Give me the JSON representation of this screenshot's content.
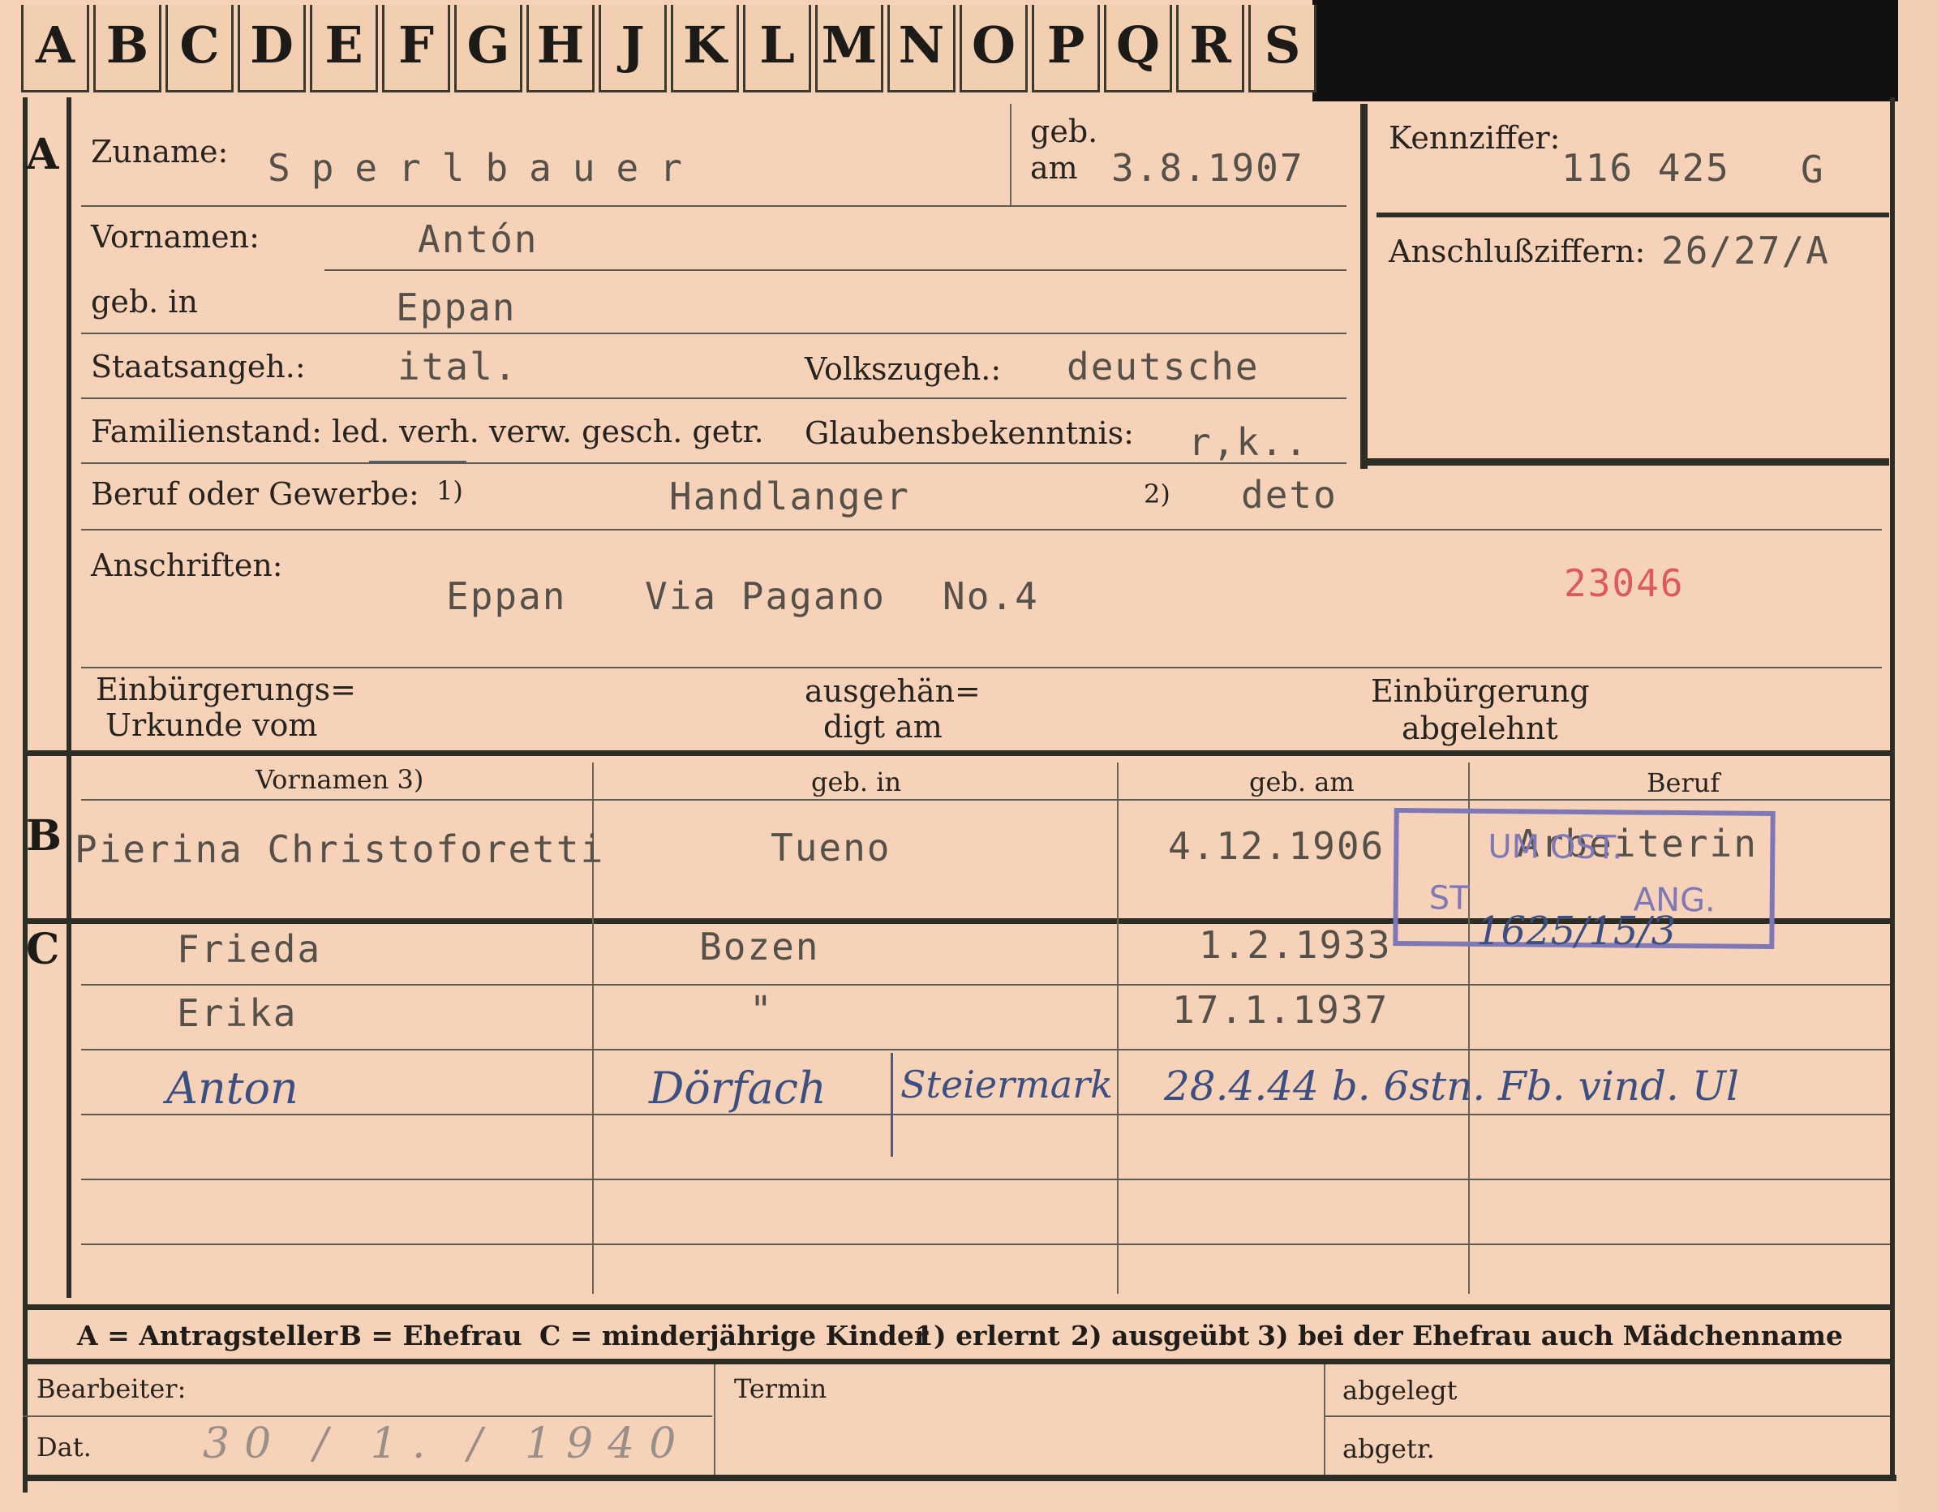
{
  "index_tabs": [
    "A",
    "B",
    "C",
    "D",
    "E",
    "F",
    "G",
    "H",
    "J",
    "K",
    "L",
    "M",
    "N",
    "O",
    "P",
    "Q",
    "R",
    "S"
  ],
  "sections": {
    "a": "A",
    "b": "B",
    "c": "C"
  },
  "applicant": {
    "surname_label": "Zuname:",
    "surname": "Sperlbauer",
    "born_label_1": "geb.",
    "born_label_2": "am",
    "born_date": "3.8.1907",
    "first_names_label": "Vornamen:",
    "first_names": "Antón",
    "birthplace_label": "geb. in",
    "birthplace": "Eppan",
    "citizenship_label": "Staatsangeh.:",
    "citizenship": "ital.",
    "ethnicity_label": "Volkszugeh.:",
    "ethnicity": "deutsche",
    "marital_label": "Familienstand: led. verh. verw. gesch. getr.",
    "religion_label": "Glaubensbekenntnis:",
    "religion": "r,k..",
    "occupation_label": "Beruf oder Gewerbe:",
    "occ_note_1": "1)",
    "occupation_learned": "Handlanger",
    "occ_note_2": "2)",
    "occupation_practiced": "deto",
    "address_label": "Anschriften:",
    "address_town": "Eppan",
    "address_street": "Via Pagano",
    "address_no": "No.4",
    "red_number": "23046",
    "nat_cert_label_1": "Einbürgerungs=",
    "nat_cert_label_2": "Urkunde vom",
    "handed_label_1": "ausgehän=",
    "handed_label_2": "digt am",
    "refused_label_1": "Einbürgerung",
    "refused_label_2": "abgelehnt"
  },
  "reference": {
    "code_label": "Kennziffer:",
    "code": "116 425",
    "code_suffix": "G",
    "attach_label": "Anschlußziffern:",
    "attach": "26/27/A"
  },
  "table_headers": {
    "first_names": "Vornamen 3)",
    "born_in": "geb. in",
    "born_on": "geb. am",
    "occupation": "Beruf"
  },
  "spouse": {
    "name": "Pierina Christoforetti",
    "born_in": "Tueno",
    "born_on": "4.12.1906",
    "occupation": "Arbeiterin"
  },
  "stamp": {
    "line1": "UM OST.",
    "line2": "ST",
    "line3": "ANG.",
    "number": "1625/15/3"
  },
  "children": [
    {
      "name": "Frieda",
      "born_in": "Bozen",
      "born_on": "1.2.1933"
    },
    {
      "name": "Erika",
      "born_in": "\"",
      "born_on": "17.1.1937"
    },
    {
      "name": "Anton",
      "born_in": "Dörfach",
      "born_in_region": "Steiermark",
      "born_on": "28.4.44 b. 6stn. Fb. vind. Ul"
    }
  ],
  "legend": {
    "a": "A = Antragsteller",
    "b": "B = Ehefrau",
    "c": "C = minderjährige Kinder",
    "n1": "1) erlernt",
    "n2": "2) ausgeübt",
    "n3": "3) bei der Ehefrau auch Mädchenname"
  },
  "footer": {
    "clerk_label": "Bearbeiter:",
    "date_label": "Dat.",
    "date_value": "30 / 1. / 1940",
    "term_label": "Termin",
    "filed_label": "abgelegt",
    "deregistered_label": "abgetr."
  }
}
